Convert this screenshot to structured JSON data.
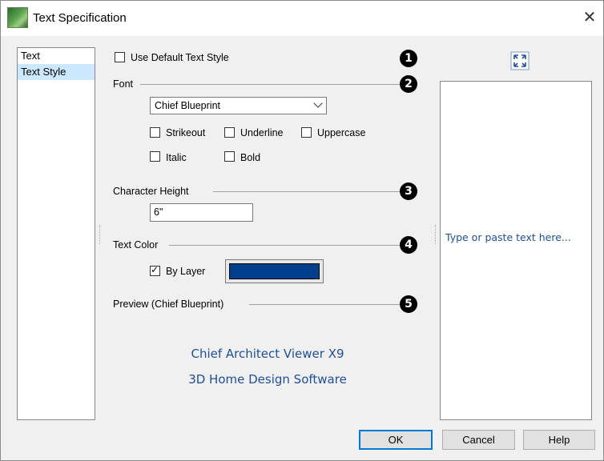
{
  "window": {
    "title": "Text Specification",
    "close_glyph": "✕"
  },
  "nav": {
    "items": [
      {
        "label": "Text",
        "selected": false
      },
      {
        "label": "Text Style",
        "selected": true
      }
    ]
  },
  "options": {
    "use_default_label": "Use Default Text Style",
    "use_default_checked": false
  },
  "font": {
    "group_label": "Font",
    "selected_font": "Chief Blueprint",
    "strikeout_label": "Strikeout",
    "underline_label": "Underline",
    "uppercase_label": "Uppercase",
    "italic_label": "Italic",
    "bold_label": "Bold"
  },
  "height": {
    "group_label": "Character Height",
    "value": "6\""
  },
  "color": {
    "group_label": "Text Color",
    "by_layer_label": "By Layer",
    "by_layer_checked": true,
    "swatch_color": "#003f8c"
  },
  "preview": {
    "group_label": "Preview (Chief Blueprint)",
    "line1": "Chief Architect Viewer X9",
    "line2": "3D Home Design Software",
    "pane_placeholder": "Type or paste text here..."
  },
  "markers": [
    "1",
    "2",
    "3",
    "4",
    "5"
  ],
  "buttons": {
    "ok": "OK",
    "cancel": "Cancel",
    "help": "Help"
  },
  "icons": {
    "app": "chief-architect-app-icon",
    "expand": "expand-icon",
    "close": "close-icon"
  }
}
